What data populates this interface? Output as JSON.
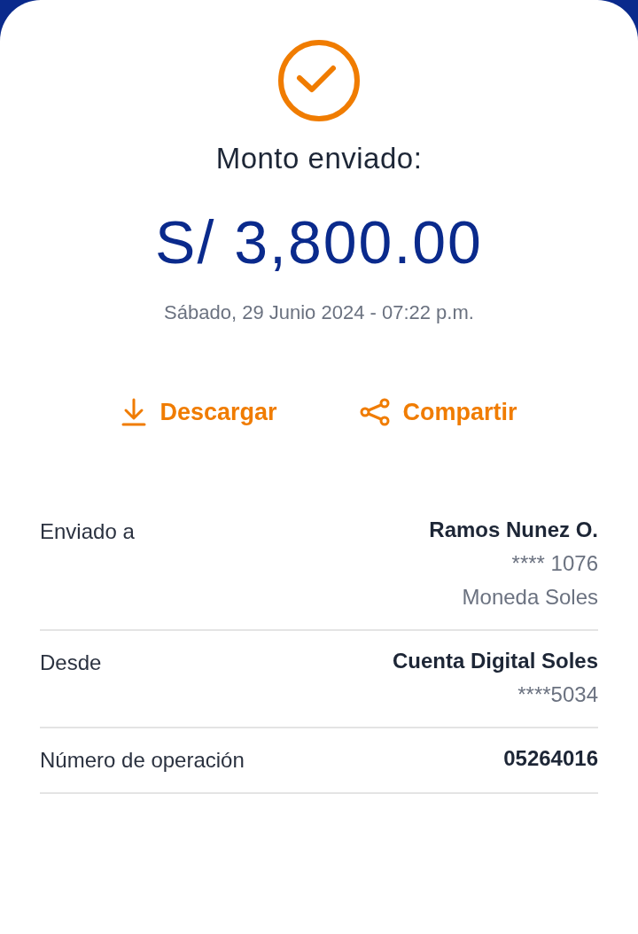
{
  "title": "Monto enviado:",
  "amount": "S/ 3,800.00",
  "date": "Sábado, 29 Junio 2024 - 07:22 p.m.",
  "actions": [
    {
      "kind": "download",
      "label": "Descargar"
    },
    {
      "kind": "share",
      "label": "Compartir"
    }
  ],
  "details": [
    {
      "label": "Enviado a",
      "values": [
        {
          "kind": "primary",
          "text": "Ramos Nunez O."
        },
        {
          "kind": "secondary",
          "text": "**** 1076"
        },
        {
          "kind": "secondary",
          "text": "Moneda Soles"
        }
      ]
    },
    {
      "label": "Desde",
      "values": [
        {
          "kind": "primary",
          "text": "Cuenta Digital Soles"
        },
        {
          "kind": "secondary",
          "text": "****5034"
        }
      ]
    },
    {
      "label": "Número de operación",
      "values": [
        {
          "kind": "primary",
          "text": "05264016"
        }
      ]
    }
  ]
}
